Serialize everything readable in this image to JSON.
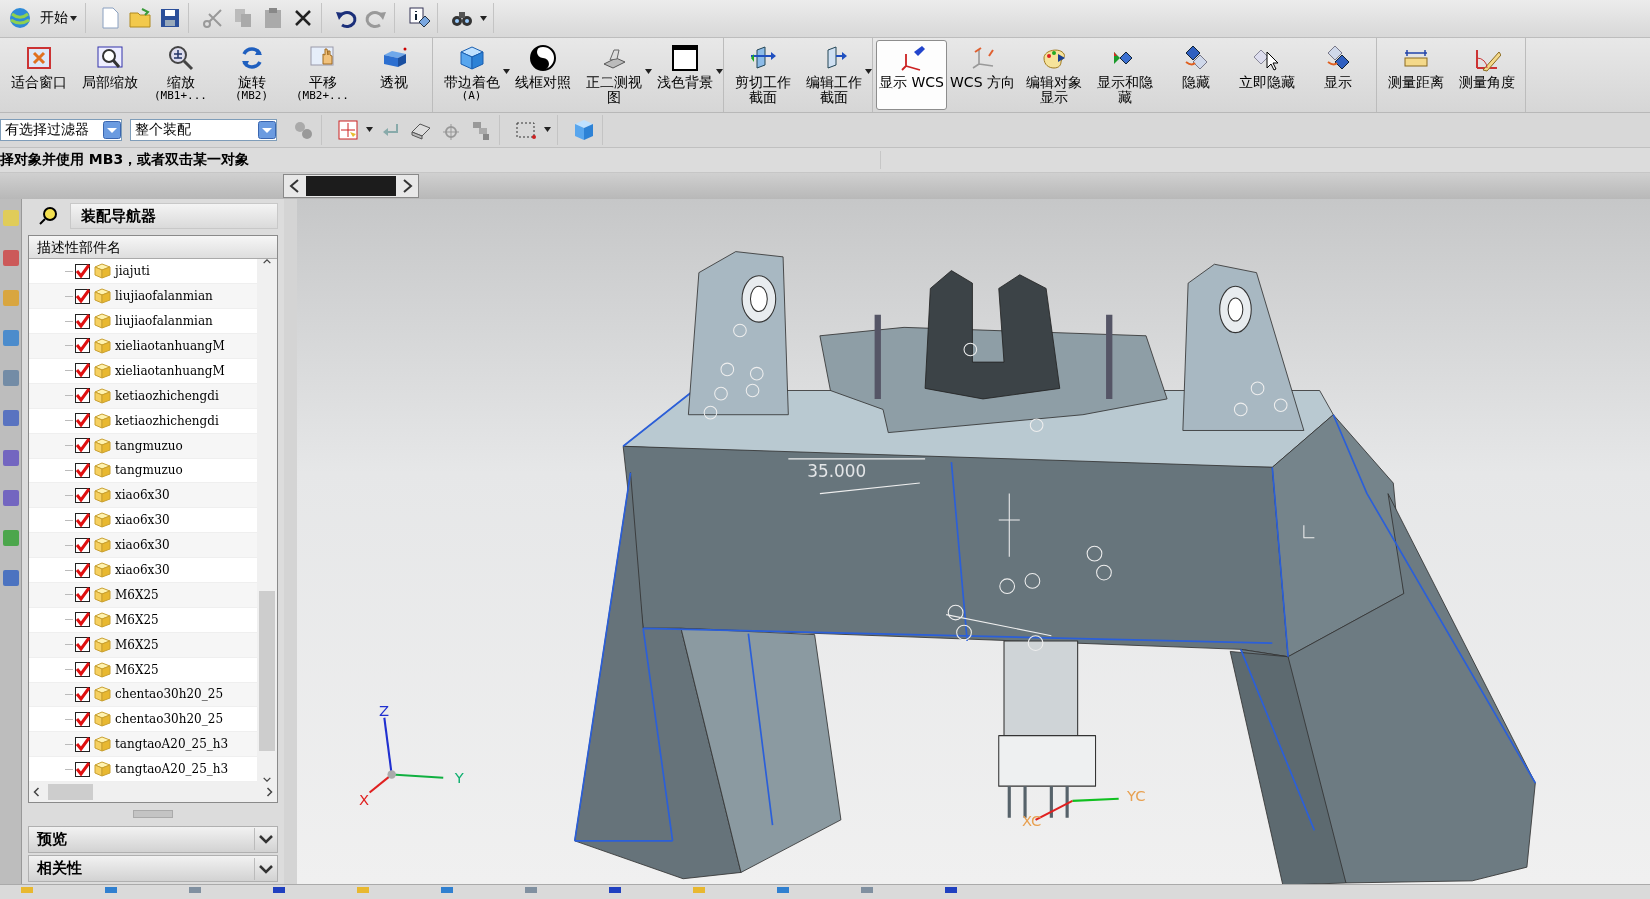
{
  "start_menu": {
    "label": "开始"
  },
  "view_toolbar": {
    "groups": [
      [
        {
          "label": "适合窗口",
          "dropdown": false,
          "selected": false
        },
        {
          "label": "局部缩放",
          "dropdown": false,
          "selected": false
        },
        {
          "label": "缩放",
          "hint": "(MB1+...",
          "dropdown": false,
          "selected": false
        },
        {
          "label": "旋转",
          "hint": "(MB2)",
          "dropdown": false,
          "selected": false
        },
        {
          "label": "平移",
          "hint": "(MB2+...",
          "dropdown": false,
          "selected": false
        },
        {
          "label": "透视",
          "dropdown": false,
          "selected": false
        }
      ],
      [
        {
          "label": "带边着色",
          "hint": "(A)",
          "dropdown": true,
          "selected": false
        },
        {
          "label": "线框对照",
          "dropdown": false,
          "selected": false
        },
        {
          "label": "正二测视图",
          "dropdown": true,
          "selected": false
        },
        {
          "label": "浅色背景",
          "dropdown": true,
          "selected": false
        }
      ],
      [
        {
          "label": "剪切工作截面",
          "dropdown": false,
          "selected": false
        },
        {
          "label": "编辑工作截面",
          "dropdown": true,
          "selected": false
        }
      ],
      [
        {
          "label": "显示 WCS",
          "dropdown": false,
          "selected": true
        },
        {
          "label": "WCS 方向",
          "dropdown": false,
          "selected": false
        },
        {
          "label": "编辑对象显示",
          "dropdown": false,
          "selected": false
        },
        {
          "label": "显示和隐藏",
          "dropdown": false,
          "selected": false
        },
        {
          "label": "隐藏",
          "dropdown": false,
          "selected": false
        },
        {
          "label": "立即隐藏",
          "dropdown": false,
          "selected": false
        },
        {
          "label": "显示",
          "dropdown": false,
          "selected": false
        }
      ],
      [
        {
          "label": "测量距离",
          "dropdown": false,
          "selected": false
        },
        {
          "label": "测量角度",
          "dropdown": false,
          "selected": false
        }
      ]
    ]
  },
  "selection_bar": {
    "filter": {
      "value": "有选择过滤器"
    },
    "scope": {
      "value": "整个装配"
    }
  },
  "prompt": "择对象并使用 MB3，或者双击某一对象",
  "navigator": {
    "title": "装配导航器",
    "column": "描述性部件名",
    "rows": [
      {
        "name": "jiajuti",
        "checked": true
      },
      {
        "name": "liujiaofalanmian",
        "checked": true
      },
      {
        "name": "liujiaofalanmian",
        "checked": true
      },
      {
        "name": "xieliaotanhuangM",
        "checked": true
      },
      {
        "name": "xieliaotanhuangM",
        "checked": true
      },
      {
        "name": "ketiaozhichengdi",
        "checked": true
      },
      {
        "name": "ketiaozhichengdi",
        "checked": true
      },
      {
        "name": "tangmuzuo",
        "checked": true
      },
      {
        "name": "tangmuzuo",
        "checked": true
      },
      {
        "name": "xiao6x30",
        "checked": true
      },
      {
        "name": "xiao6x30",
        "checked": true
      },
      {
        "name": "xiao6x30",
        "checked": true
      },
      {
        "name": "xiao6x30",
        "checked": true
      },
      {
        "name": "M6X25",
        "checked": true
      },
      {
        "name": "M6X25",
        "checked": true
      },
      {
        "name": "M6X25",
        "checked": true
      },
      {
        "name": "M6X25",
        "checked": true
      },
      {
        "name": "chentao30h20_25",
        "checked": true
      },
      {
        "name": "chentao30h20_25",
        "checked": true
      },
      {
        "name": "tangtaoA20_25_h3",
        "checked": true
      },
      {
        "name": "tangtaoA20_25_h3",
        "checked": true
      }
    ],
    "panels": [
      {
        "label": "预览",
        "expanded": false
      },
      {
        "label": "相关性",
        "expanded": false
      }
    ]
  },
  "viewport": {
    "dimension": "35.000",
    "absolute_axes": {
      "z": "Z",
      "y": "Y",
      "x": "X"
    },
    "wcs_axes": {
      "y": "YC",
      "x": "XC"
    }
  }
}
